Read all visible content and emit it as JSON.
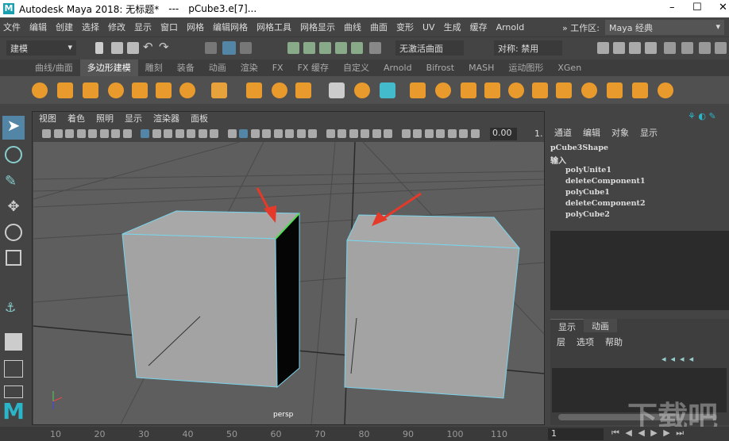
{
  "title": {
    "app": "Autodesk Maya 2018: 无标题*",
    "sep": "---",
    "object": "pCube3.e[7]...",
    "min": "–",
    "max": "☐",
    "close": "✕"
  },
  "menu": [
    "文件",
    "编辑",
    "创建",
    "选择",
    "修改",
    "显示",
    "窗口",
    "网格",
    "编辑网格",
    "网格工具",
    "网格显示",
    "曲线",
    "曲面",
    "变形",
    "UV",
    "生成",
    "缓存",
    "Arnold"
  ],
  "workspace": {
    "label": "» 工作区:",
    "value": "Maya 经典"
  },
  "toolbar": {
    "mode": "建模",
    "surface": "无激活曲面",
    "symmetry": "对称: 禁用"
  },
  "shelf_tabs": [
    "曲线/曲面",
    "多边形建模",
    "雕刻",
    "装备",
    "动画",
    "渲染",
    "FX",
    "FX 缓存",
    "自定义",
    "Arnold",
    "Bifrost",
    "MASH",
    "运动图形",
    "XGen"
  ],
  "shelf_active": 1,
  "viewport": {
    "menu": [
      "视图",
      "着色",
      "照明",
      "显示",
      "渲染器",
      "面板"
    ],
    "field": "0.00",
    "field2": "1.",
    "camera": "persp"
  },
  "channel_box": {
    "menu": [
      "通道",
      "编辑",
      "对象",
      "显示"
    ],
    "shape": "pCube3Shape",
    "inputs_label": "输入",
    "inputs": [
      "polyUnite1",
      "deleteComponent1",
      "polyCube1",
      "deleteComponent2",
      "polyCube2"
    ]
  },
  "layer_editor": {
    "tabs": [
      "显示",
      "动画"
    ],
    "menu": [
      "层",
      "选项",
      "帮助"
    ]
  },
  "timeline": {
    "ticks": [
      "10",
      "20",
      "30",
      "40",
      "50",
      "60",
      "70",
      "80",
      "90",
      "100",
      "110"
    ],
    "current": "1"
  },
  "watermark": "下载吧",
  "colors": {
    "accent": "#5285a6",
    "edge_highlight": "#6fd0e8",
    "arrow": "#e53a2a"
  }
}
